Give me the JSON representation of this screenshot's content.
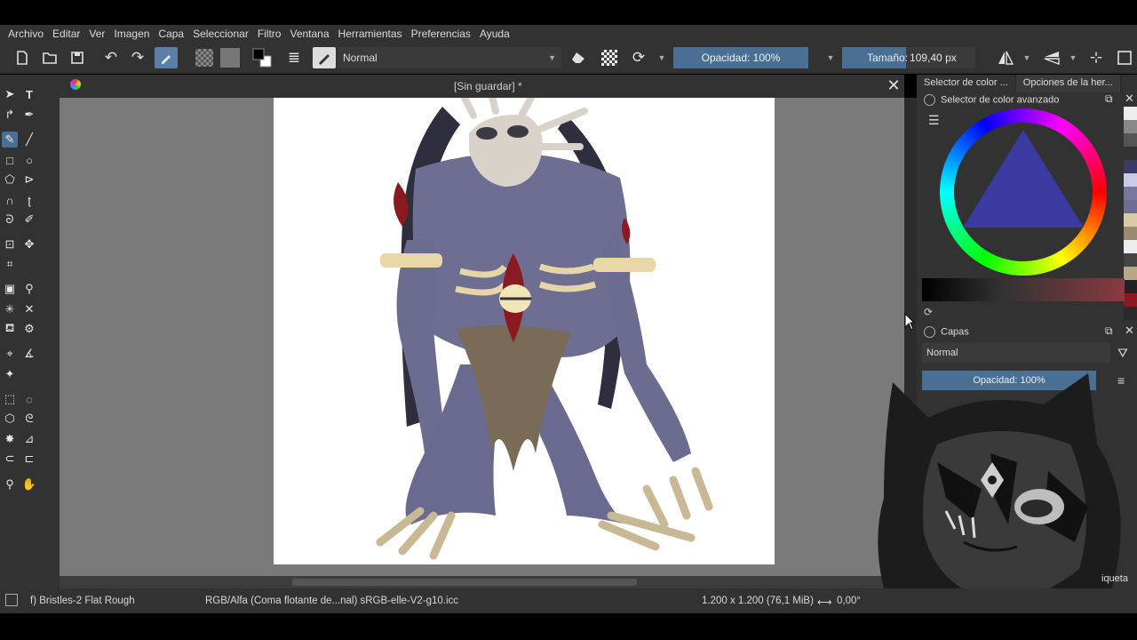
{
  "menubar": {
    "items": [
      "Archivo",
      "Editar",
      "Ver",
      "Imagen",
      "Capa",
      "Seleccionar",
      "Filtro",
      "Ventana",
      "Herramientas",
      "Preferencias",
      "Ayuda"
    ]
  },
  "toolbar": {
    "blend_mode": "Normal",
    "opacity_label": "Opacidad: 100%",
    "size_label": "Tamaño:",
    "size_value": "109,40 px"
  },
  "document": {
    "title": "[Sin guardar] *"
  },
  "dock": {
    "tabs": [
      "Selector de color ...",
      "Opciones de la her..."
    ],
    "color_panel_title": "Selector de color avanzado",
    "layers_title": "Capas",
    "layers_mode": "Normal",
    "layers_opacity": "Opacidad:  100%",
    "layers_partial_label": "iqueta"
  },
  "statusbar": {
    "brush": "f) Bristles-2 Flat Rough",
    "color_space": "RGB/Alfa (Coma flotante de...nal)  sRGB-elle-V2-g10.icc",
    "dimensions": "1.200 x 1.200 (76,1 MiB)",
    "rotation": "0,00°"
  },
  "colors": {
    "accent": "#4a6f95",
    "panel_bg": "#323232",
    "canvas_bg": "#7a7a7a",
    "creature_body": "#6e6e92",
    "eye_red": "#8a1a20"
  }
}
